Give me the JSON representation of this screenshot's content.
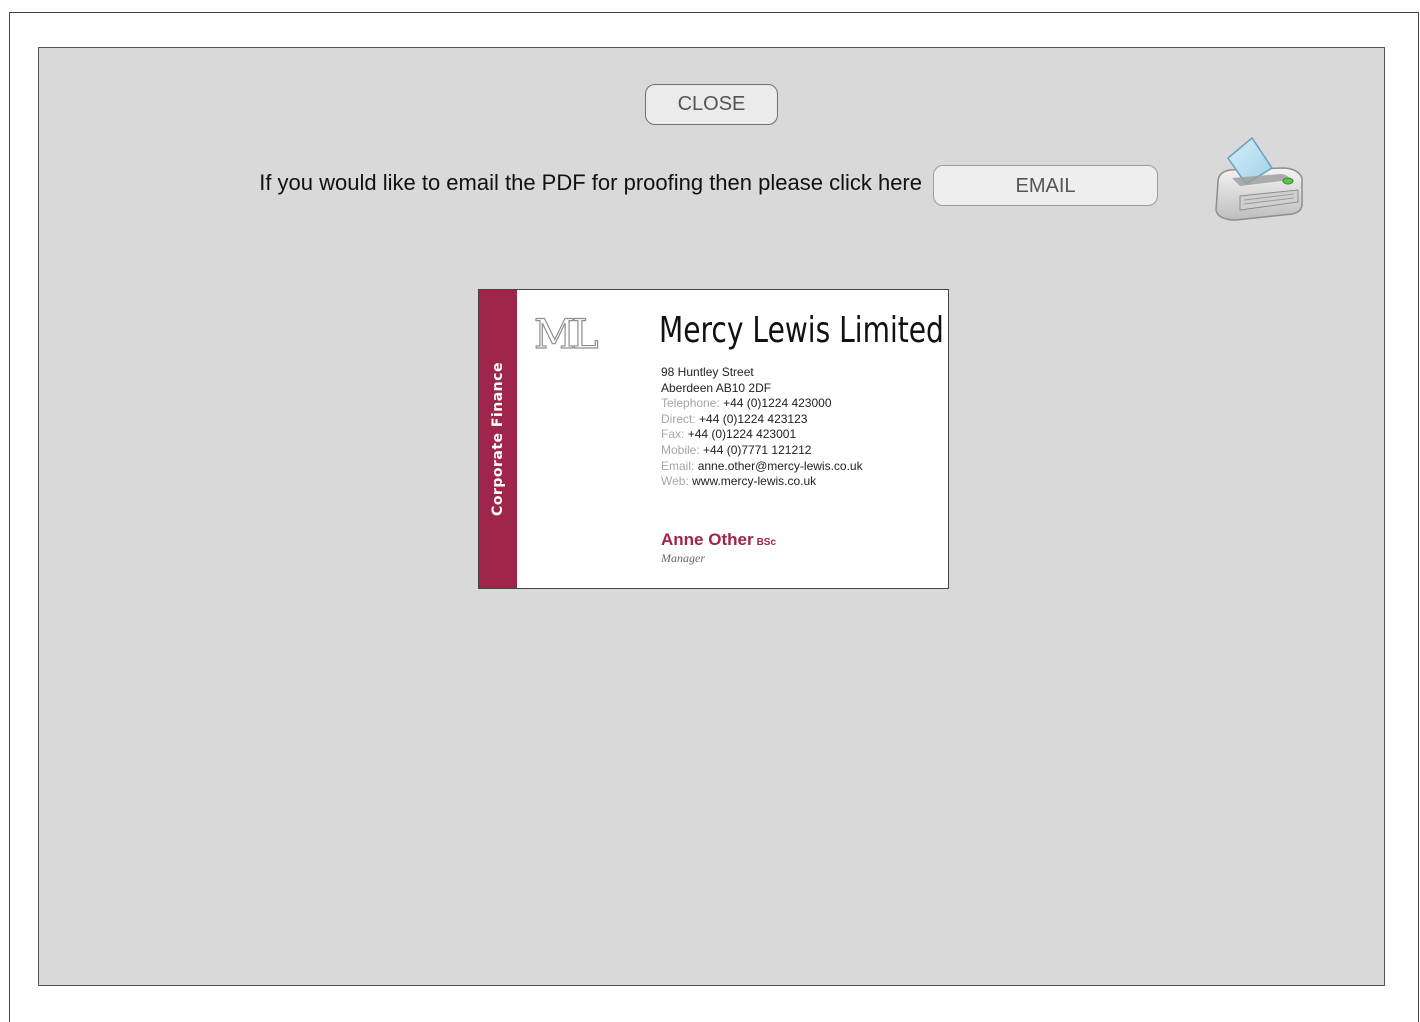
{
  "buttons": {
    "close_label": "CLOSE",
    "email_label": "EMAIL"
  },
  "email_prompt": "If you would like to email the PDF for proofing then please click here",
  "icons": {
    "printer": "printer-icon"
  },
  "colors": {
    "panel_bg": "#d9d9d9",
    "brand": "#a0254a"
  },
  "card": {
    "band_label": "Corporate Finance",
    "monogram": "ML",
    "company": "Mercy Lewis Limited",
    "address_line1": "98 Huntley Street",
    "address_line2": "Aberdeen AB10 2DF",
    "telephone_label": "Telephone:",
    "telephone": "+44 (0)1224 423000",
    "direct_label": "Direct:",
    "direct": "+44 (0)1224 423123",
    "fax_label": "Fax:",
    "fax": "+44 (0)1224 423001",
    "mobile_label": "Mobile:",
    "mobile": "+44 (0)7771 121212",
    "email_label": "Email:",
    "email": "anne.other@mercy-lewis.co.uk",
    "web_label": "Web:",
    "web": "www.mercy-lewis.co.uk",
    "person_name": "Anne Other",
    "person_qualification": "BSc",
    "person_role": "Manager"
  }
}
